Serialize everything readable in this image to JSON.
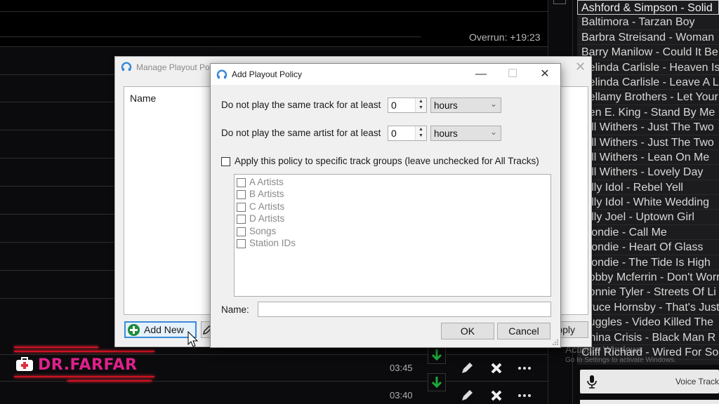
{
  "background": {
    "overrun_label": "Overrun: +19:23",
    "rows": [
      {
        "time": "03:45"
      },
      {
        "time": "03:40"
      }
    ],
    "watermark": {
      "line1": "Activate Windows",
      "line2": "Go to Settings to activate Windows."
    }
  },
  "playlist": {
    "items": [
      "Ashford & Simpson - Solid",
      "Baltimora - Tarzan Boy",
      "Barbra Streisand - Woman",
      "Barry Manilow - Could It Be",
      "Belinda Carlisle - Heaven Is",
      "Belinda Carlisle - Leave A Light",
      "Bellamy Brothers - Let Your",
      "Ben E. King - Stand By Me",
      "Bill Withers - Just The Two",
      "Bill Withers - Just The Two",
      "Bill Withers - Lean On Me",
      "Bill Withers - Lovely Day",
      "Billy Idol - Rebel Yell",
      "Billy Idol - White Wedding",
      "Billy Joel - Uptown Girl",
      "Blondie - Call Me",
      "Blondie - Heart Of Glass",
      "Blondie - The Tide Is High",
      "Bobby Mcferrin - Don't Worry",
      "Bonnie Tyler - Streets Of Li",
      "Bruce Hornsby - That's Just",
      "Buggles - Video Killed The",
      "China Crisis - Black Man R",
      "Cliff Richard - Wired For So"
    ],
    "selected_index": 0,
    "voice_track_label": "Voice Track"
  },
  "logo": {
    "text": "DR.FARFAR"
  },
  "manage_dialog": {
    "title": "Manage Playout Policies",
    "list_header": "Name",
    "add_new_label": "Add New",
    "apply_label": "Apply"
  },
  "add_dialog": {
    "title": "Add Playout Policy",
    "track_rule": {
      "label": "Do not play the same track for at least",
      "value": "0",
      "unit": "hours"
    },
    "artist_rule": {
      "label": "Do not play the same artist for at least",
      "value": "0",
      "unit": "hours"
    },
    "apply_groups_label": "Apply this policy to specific track groups (leave unchecked for All Tracks)",
    "apply_groups_checked": false,
    "groups": [
      "A Artists",
      "B Artists",
      "C Artists",
      "D Artists",
      "Songs",
      "Station IDs"
    ],
    "name_label": "Name:",
    "name_value": "",
    "ok_label": "OK",
    "cancel_label": "Cancel"
  },
  "colors": {
    "accent_blue": "#3b8ad9",
    "add_green": "#1e8a3a",
    "arrow_green": "#1fa83a",
    "logo_pink": "#e0208a"
  }
}
